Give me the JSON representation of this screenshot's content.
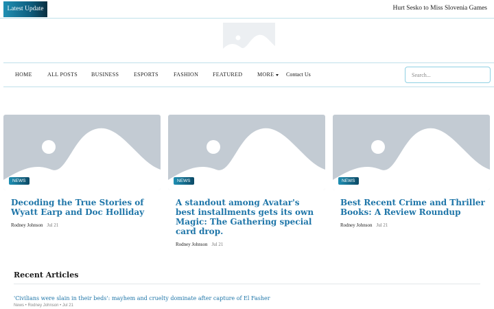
{
  "topbar": {
    "latest_label": "Latest  Update",
    "ticker_text": "Hurt Sesko to Miss Slovenia Games"
  },
  "logo": {
    "icon": "image-placeholder-icon"
  },
  "nav": {
    "items": [
      "HOME",
      "ALL POSTS",
      "BUSINESS",
      "ESPORTS",
      "FASHION",
      "FEATURED",
      "MORE",
      "Contact Us"
    ]
  },
  "search": {
    "placeholder": "Search..."
  },
  "cards": [
    {
      "badge": "NEWS",
      "title": "Decoding the True Stories of Wyatt Earp and Doc Holliday",
      "author": "Rodney Johnson",
      "date": "Jul 21"
    },
    {
      "badge": "NEWS",
      "title": "A standout among Avatar's best installments gets its own Magic: The Gathering special card drop.",
      "author": "Rodney Johnson",
      "date": "Jul 21"
    },
    {
      "badge": "NEWS",
      "title": "Best Recent Crime and Thriller Books: A Review Roundup",
      "author": "Rodney Johnson",
      "date": "Jul 21"
    }
  ],
  "recent": {
    "heading": "Recent Articles",
    "articles": [
      {
        "title": "'Civilians were slain in their beds': mayhem and cruelty dominate after capture of El Fasher",
        "meta": "News • Rodney Johnson • Jul 21"
      }
    ]
  },
  "colors": {
    "accent": "#1e75a8",
    "brand_gradient_start": "#1f8fb3",
    "placeholder_bg": "#c3cbd3"
  }
}
